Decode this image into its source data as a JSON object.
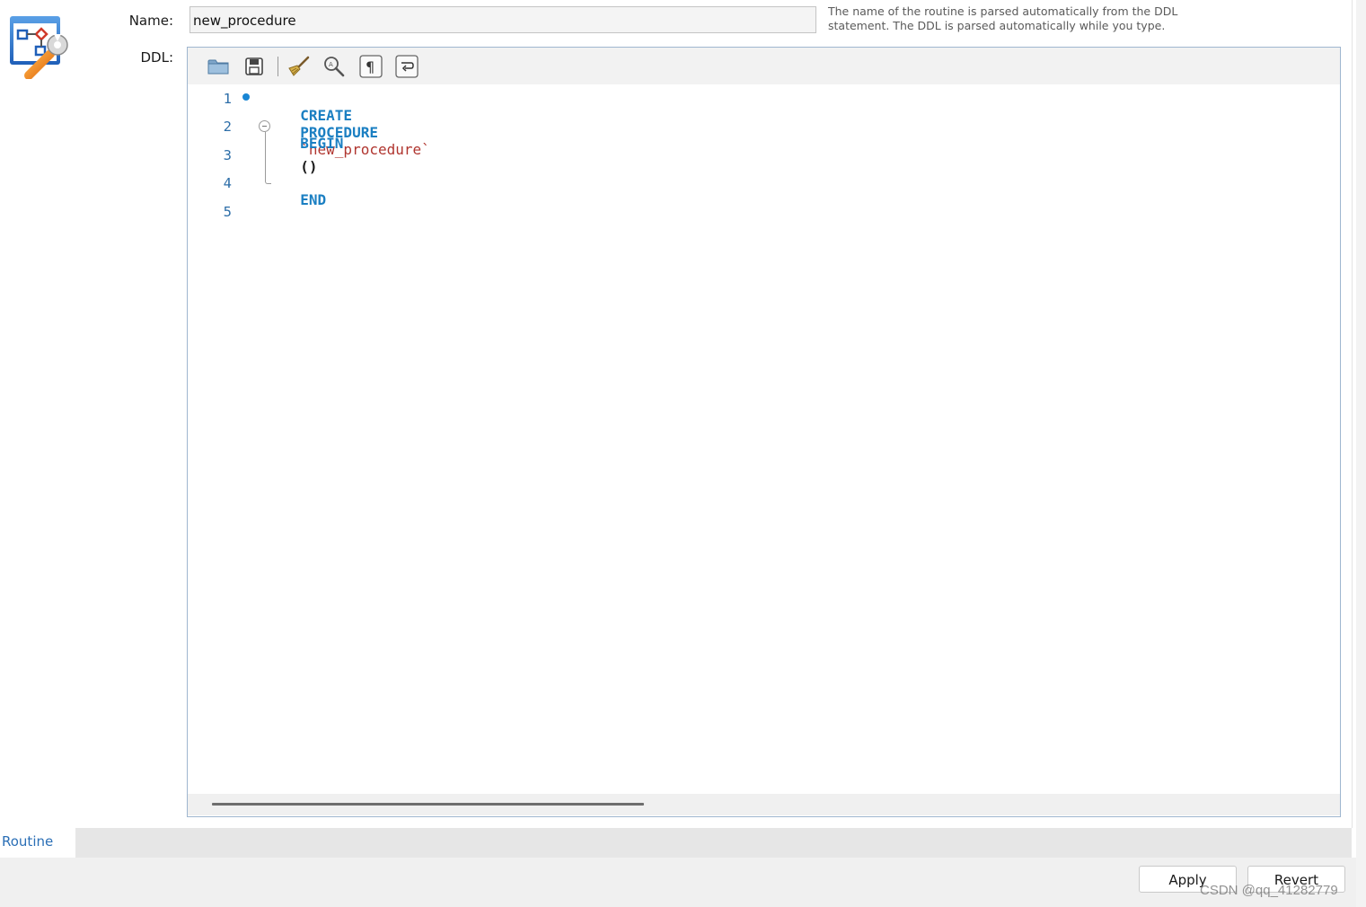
{
  "header": {
    "name_label": "Name:",
    "ddl_label": "DDL:",
    "name_value": "new_procedure",
    "hint": "The name of the routine is parsed automatically from the DDL statement. The DDL is parsed automatically while you type."
  },
  "toolbar": {
    "icons": [
      "open-folder-icon",
      "save-icon",
      "beautify-broom-icon",
      "find-magnifier-icon",
      "invisible-chars-pilcrow-icon",
      "word-wrap-icon"
    ]
  },
  "editor": {
    "line_numbers": [
      "1",
      "2",
      "3",
      "4",
      "5"
    ],
    "code": {
      "create": "CREATE",
      "procedure": "PROCEDURE",
      "name": "`new_procedure`",
      "parens": "()",
      "begin": "BEGIN",
      "end": "END"
    }
  },
  "tabs": [
    {
      "label": "Routine",
      "active": true
    }
  ],
  "buttons": {
    "apply": "Apply",
    "revert": "Revert"
  },
  "watermark": "CSDN @qq_41282779",
  "colors": {
    "keyword": "#1b7fc2",
    "string": "#b0352f",
    "line_number": "#2d6ea8",
    "tab_active_text": "#2b6fb6"
  }
}
